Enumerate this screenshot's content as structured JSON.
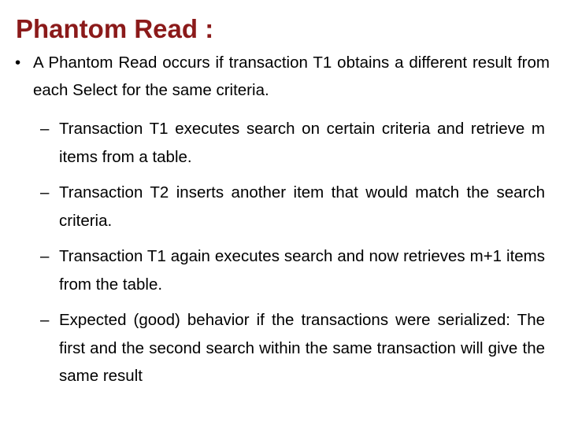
{
  "slide": {
    "background_color": "#ffffff",
    "title": "Phantom Read :",
    "title_color": "#8B1A1A",
    "body_color": "#000000",
    "bullet_marker_level1": "•",
    "bullet_marker_level2": "–"
  },
  "content": {
    "level1": [
      {
        "marker": "•",
        "text": "A Phantom Read occurs if transaction T1 obtains a different result from each Select for the same criteria."
      }
    ],
    "level2": [
      {
        "marker": "–",
        "text": "Transaction T1 executes search on certain criteria and retrieve m items from a table."
      },
      {
        "marker": "–",
        "text": "Transaction T2 inserts another item that would match the search criteria."
      },
      {
        "marker": "–",
        "text": "Transaction T1 again executes search and now retrieves m+1 items from the table."
      },
      {
        "marker": "–",
        "text": "Expected (good) behavior if the transactions were serialized: The first and the second search within the same transaction will give the same result"
      }
    ]
  }
}
